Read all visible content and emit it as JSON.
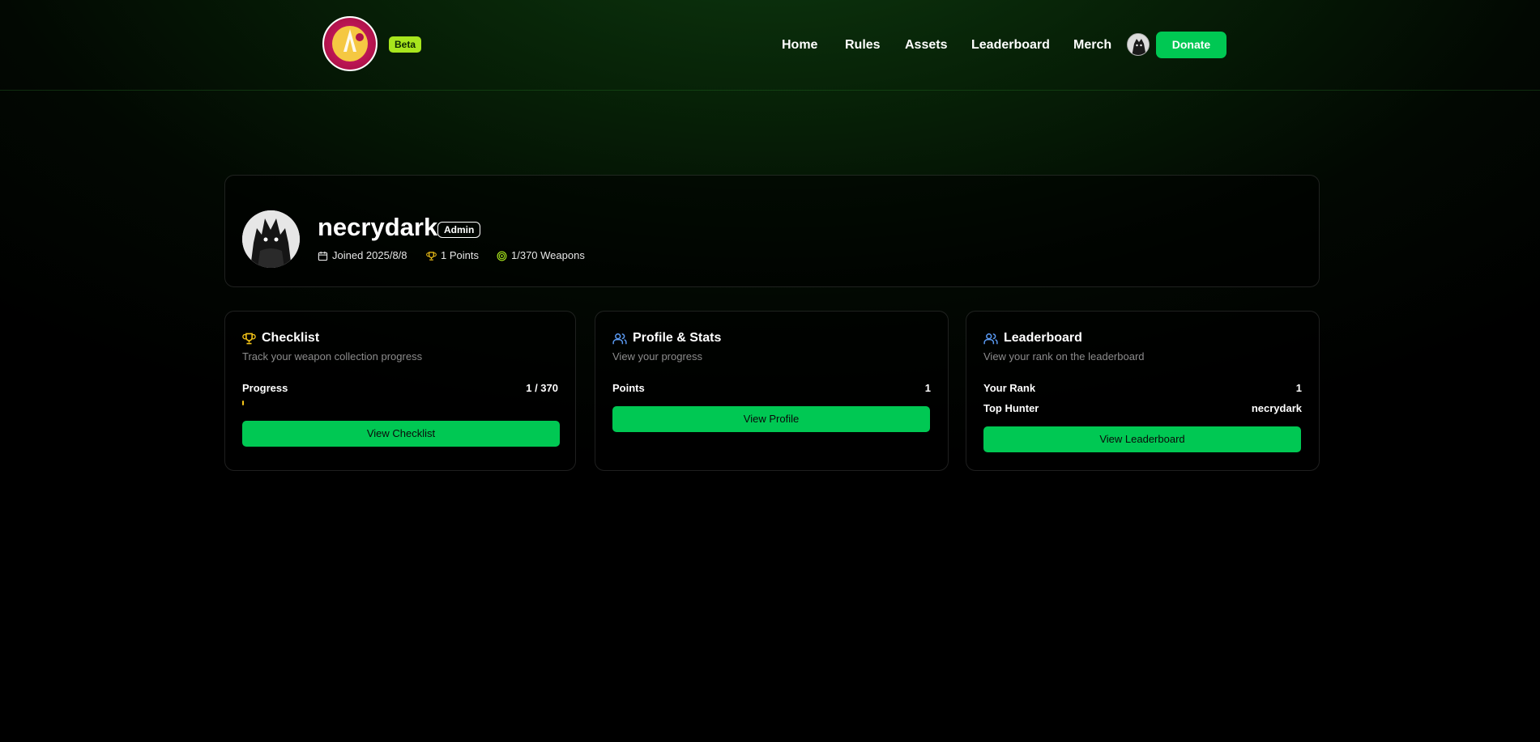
{
  "header": {
    "beta_label": "Beta",
    "nav": [
      "Home",
      "Rules",
      "Assets",
      "Leaderboard",
      "Merch"
    ],
    "donate_label": "Donate"
  },
  "profile": {
    "username": "necrydark",
    "role_badge": "Admin",
    "joined": "Joined 2025/8/8",
    "points": "1 Points",
    "weapons": "1/370 Weapons"
  },
  "checklist_card": {
    "title": "Checklist",
    "subtitle": "Track your weapon collection progress",
    "progress_label": "Progress",
    "progress_value": "1 / 370",
    "progress_fraction": 0.0027,
    "button_label": "View Checklist"
  },
  "stats_card": {
    "title": "Profile & Stats",
    "subtitle": "View your progress",
    "points_label": "Points",
    "points_value": "1",
    "button_label": "View Profile"
  },
  "leaderboard_card": {
    "title": "Leaderboard",
    "subtitle": "View your rank on the leaderboard",
    "rank_label": "Your Rank",
    "rank_value": "1",
    "top_hunter_label": "Top Hunter",
    "top_hunter_value": "necrydark",
    "button_label": "View Leaderboard"
  },
  "colors": {
    "accent_green": "#00c853",
    "beta_lime": "#a8e61d",
    "trophy_gold": "#f5c518",
    "users_blue": "#5b9cf5"
  }
}
